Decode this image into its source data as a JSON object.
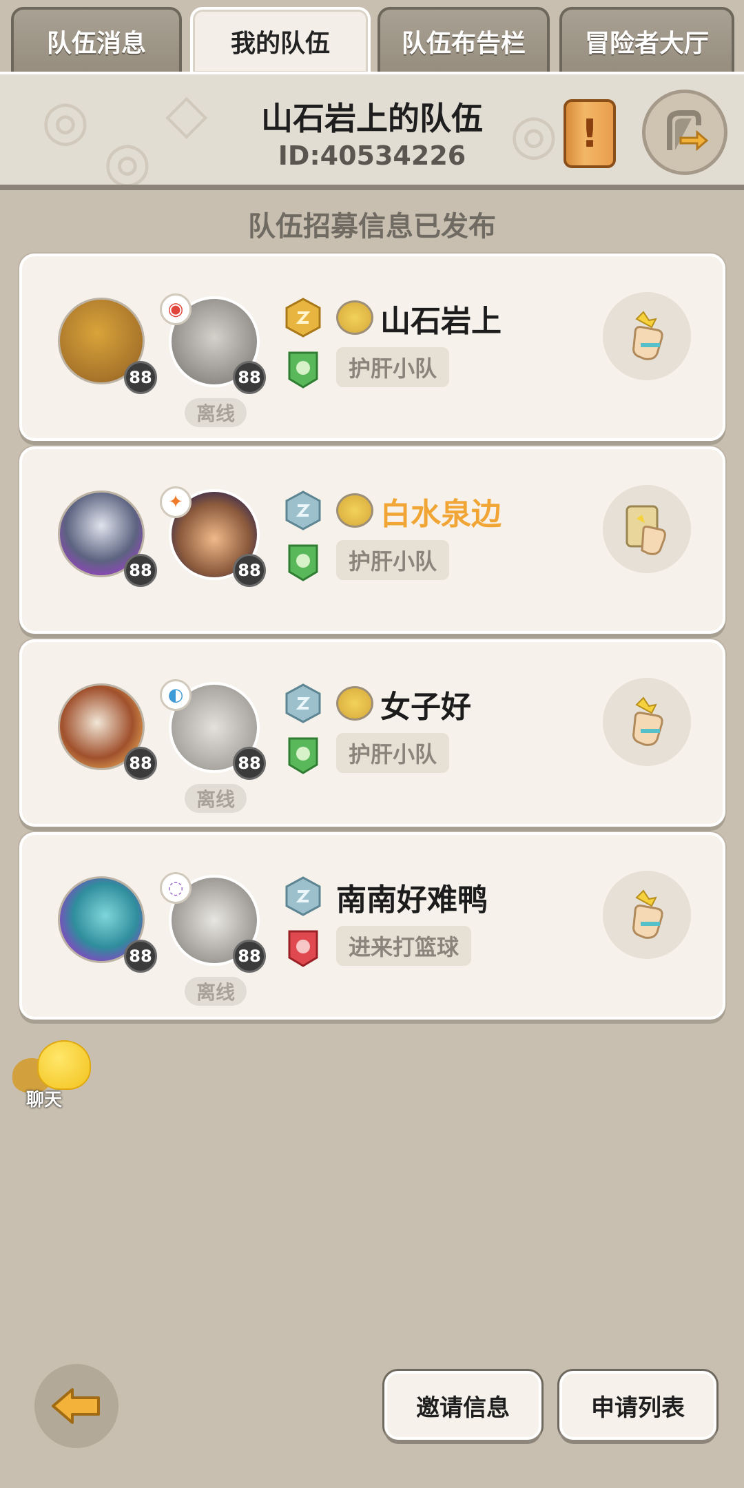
{
  "tabs": [
    {
      "label": "队伍消息"
    },
    {
      "label": "我的队伍"
    },
    {
      "label": "队伍布告栏"
    },
    {
      "label": "冒险者大厅"
    }
  ],
  "header": {
    "team_name": "山石岩上的队伍",
    "team_id": "ID:40534226"
  },
  "recruit_status": "队伍招募信息已发布",
  "members": [
    {
      "name": "山石岩上",
      "squad": "护肝小队",
      "pet_level": "88",
      "char_level": "88",
      "status": "离线",
      "name_color": "#1c1c1c"
    },
    {
      "name": "白水泉边",
      "squad": "护肝小队",
      "pet_level": "88",
      "char_level": "88",
      "status": "",
      "name_color": "#f0a534"
    },
    {
      "name": "女子好",
      "squad": "护肝小队",
      "pet_level": "88",
      "char_level": "88",
      "status": "离线",
      "name_color": "#1c1c1c"
    },
    {
      "name": "南南好难鸭",
      "squad": "进来打篮球",
      "pet_level": "88",
      "char_level": "88",
      "status": "离线",
      "name_color": "#1c1c1c"
    }
  ],
  "chat": {
    "label": "聊天"
  },
  "footer": {
    "invite_label": "邀请信息",
    "apply_label": "申请列表"
  },
  "colors": {
    "background": "#c8bfb0",
    "card": "#f6f2eb",
    "highlight_name": "#f0a534"
  }
}
